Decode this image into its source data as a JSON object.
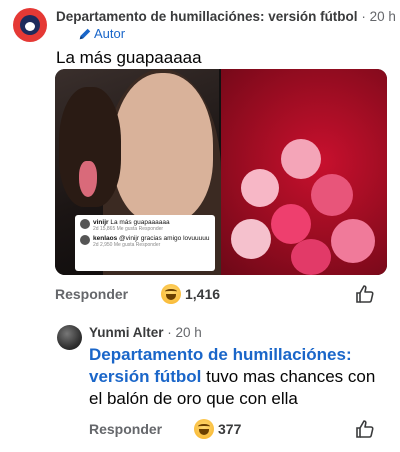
{
  "comment": {
    "author": "Departamento de humillaciónes: versión fútbol",
    "separator": " · ",
    "time": "20 h",
    "badge": "Autor",
    "text": "La más guapaaaaa",
    "media": {
      "overlay": {
        "line1_user": "vinijr",
        "line1_text": "La más guapaaaaaa",
        "line1_meta": "2d   15,865 Me gusta   Responder",
        "line2_user": "kenlaos",
        "line2_text": "@vinijr gracias amigo lovuuuuu",
        "line2_meta": "2d   2,950 Me gusta   Responder"
      }
    },
    "reply_label": "Responder",
    "reaction_count": "1,416"
  },
  "reply": {
    "author": "Yunmi Alter",
    "separator": " · ",
    "time": "20 h",
    "mention": "Departamento de humillaciónes: versión fútbol",
    "text": " tuvo mas chances con el balón de oro que con ella",
    "reply_label": "Responder",
    "reaction_count": "377"
  },
  "colors": {
    "link_blue": "#1a66c9",
    "meta_gray": "#65676b"
  }
}
